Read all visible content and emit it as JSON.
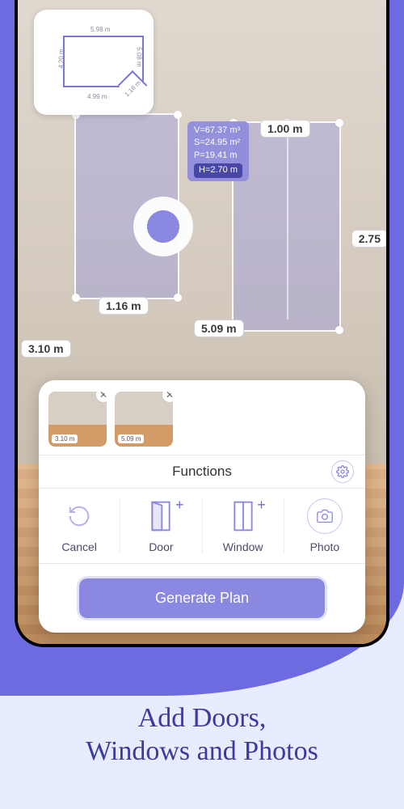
{
  "page_title": "Add Doors,\nWindows and Photos",
  "floorplan": {
    "dims": {
      "top": "5.98 m",
      "left": "4.20 m",
      "right": "5.08 m",
      "bottom": "4.99 m",
      "diag": "1.16 m"
    }
  },
  "ar": {
    "stats": {
      "volume": "V=67.37 m³",
      "area": "S=24.95 m²",
      "perimeter": "P=19.41 m",
      "height": "H=2.70 m"
    },
    "labels": {
      "door_width": "1.00 m",
      "door_height": "2.75",
      "window_width": "1.16 m",
      "wall_bottom": "5.09 m",
      "wall_left": "3.10 m"
    }
  },
  "panel": {
    "title": "Functions",
    "thumbs": [
      {
        "chip": "3.10 m"
      },
      {
        "chip": "5.09 m"
      }
    ],
    "items": {
      "cancel": "Cancel",
      "door": "Door",
      "window": "Window",
      "photo": "Photo"
    },
    "generate": "Generate Plan"
  }
}
